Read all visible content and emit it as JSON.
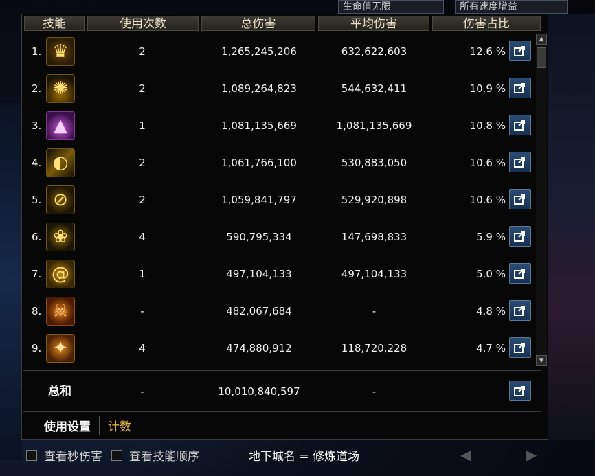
{
  "background": {
    "select_a": "生命值无限",
    "select_b": "所有速度增益"
  },
  "table": {
    "headers": [
      "技能",
      "使用次数",
      "总伤害",
      "平均伤害",
      "伤害占比"
    ],
    "rows": [
      {
        "rank": "1.",
        "icon": "crown-skill-icon",
        "uses": "2",
        "total": "1,265,245,206",
        "avg": "632,622,603",
        "pct": "12.6 %"
      },
      {
        "rank": "2.",
        "icon": "golden-burst-skill-icon",
        "uses": "2",
        "total": "1,089,264,823",
        "avg": "544,632,411",
        "pct": "10.9 %"
      },
      {
        "rank": "3.",
        "icon": "purple-aura-skill-icon",
        "uses": "1",
        "total": "1,081,135,669",
        "avg": "1,081,135,669",
        "pct": "10.8 %"
      },
      {
        "rank": "4.",
        "icon": "whirl-skill-icon",
        "uses": "2",
        "total": "1,061,766,100",
        "avg": "530,883,050",
        "pct": "10.6 %"
      },
      {
        "rank": "5.",
        "icon": "slash-circle-skill-icon",
        "uses": "2",
        "total": "1,059,841,797",
        "avg": "529,920,898",
        "pct": "10.6 %"
      },
      {
        "rank": "6.",
        "icon": "flower-seal-skill-icon",
        "uses": "4",
        "total": "590,795,334",
        "avg": "147,698,833",
        "pct": "5.9 %"
      },
      {
        "rank": "7.",
        "icon": "spiral-skill-icon",
        "uses": "1",
        "total": "497,104,133",
        "avg": "497,104,133",
        "pct": "5.0 %"
      },
      {
        "rank": "8.",
        "icon": "demon-face-skill-icon",
        "uses": "-",
        "total": "482,067,684",
        "avg": "-",
        "pct": "4.8 %"
      },
      {
        "rank": "9.",
        "icon": "flame-sword-skill-icon",
        "uses": "4",
        "total": "474,880,912",
        "avg": "118,720,228",
        "pct": "4.7 %"
      }
    ],
    "total": {
      "label": "总和",
      "uses": "-",
      "total": "10,010,840,597",
      "avg": "-"
    }
  },
  "tabs": {
    "settings": "使用设置",
    "count": "计数"
  },
  "footer": {
    "check_dps": "查看秒伤害",
    "check_order": "查看技能顺序",
    "dungeon": "地下城名 = 修炼道场"
  },
  "colors": {
    "accent": "#e8b44a",
    "button": "#1f3d63",
    "header": "#2f2c27"
  }
}
